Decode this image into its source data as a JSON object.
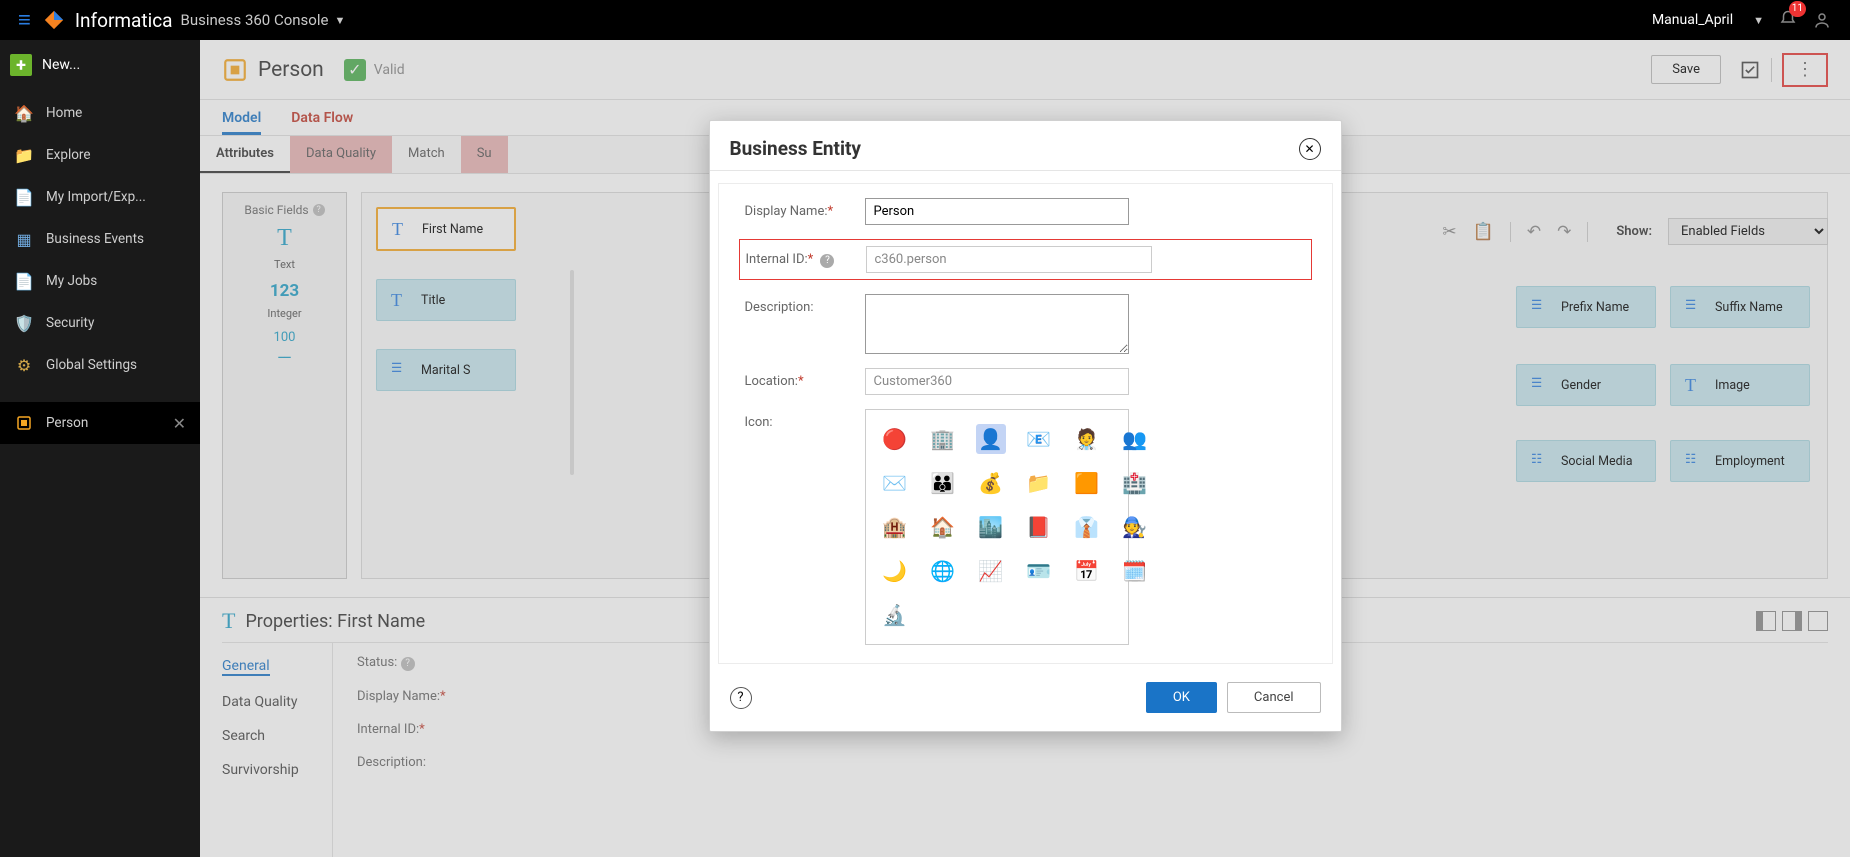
{
  "header": {
    "brand": "Informatica",
    "console": "Business 360 Console",
    "tenant": "Manual_April",
    "notifications": "11"
  },
  "sidebar": {
    "new": "New...",
    "items": [
      {
        "label": "Home"
      },
      {
        "label": "Explore"
      },
      {
        "label": "My Import/Exp..."
      },
      {
        "label": "Business Events"
      },
      {
        "label": "My Jobs"
      },
      {
        "label": "Security"
      },
      {
        "label": "Global Settings"
      }
    ],
    "active": {
      "label": "Person"
    }
  },
  "toolbar": {
    "entity": "Person",
    "valid": "Valid",
    "save": "Save"
  },
  "tabs_top": [
    "Model",
    "Data Flow"
  ],
  "subtabs": [
    "Attributes",
    "Data Quality",
    "Match",
    "Su"
  ],
  "palette": {
    "heading": "Basic Fields",
    "items": [
      {
        "icon": "T",
        "label": "Text"
      },
      {
        "icon": "123",
        "label": "Integer"
      },
      {
        "icon": "100",
        "label": ""
      }
    ]
  },
  "canvas": {
    "chips": [
      "First Name",
      "Title",
      "Marital S",
      "Prefix Name",
      "Suffix Name",
      "Gender",
      "Image",
      "Social Media",
      "Employment"
    ]
  },
  "toolbar2": {
    "show": "Show:",
    "show_value": "Enabled Fields"
  },
  "properties": {
    "title": "Properties: First Name",
    "tabs": [
      "General",
      "Data Quality",
      "Search",
      "Survivorship"
    ],
    "fields": {
      "status": "Status:",
      "display_name": "Display Name:",
      "internal_id": "Internal ID:",
      "description": "Description:"
    }
  },
  "modal": {
    "title": "Business Entity",
    "labels": {
      "display_name": "Display Name:",
      "internal_id": "Internal ID:",
      "description": "Description:",
      "location": "Location:",
      "icon": "Icon:"
    },
    "values": {
      "display_name": "Person",
      "internal_id": "c360.person",
      "location": "Customer360"
    },
    "icons": [
      "🔴",
      "🏢",
      "👤",
      "📧",
      "🧑‍⚕️",
      "👥",
      "✉️",
      "👪",
      "💰",
      "📁",
      "🟧",
      "🏥",
      "🏨",
      "🏠",
      "🏙️",
      "📕",
      "👔",
      "🧑‍🔧",
      "🌙",
      "🌐",
      "📈",
      "🪪",
      "📅",
      "🗓️",
      "🔬"
    ],
    "ok": "OK",
    "cancel": "Cancel"
  }
}
